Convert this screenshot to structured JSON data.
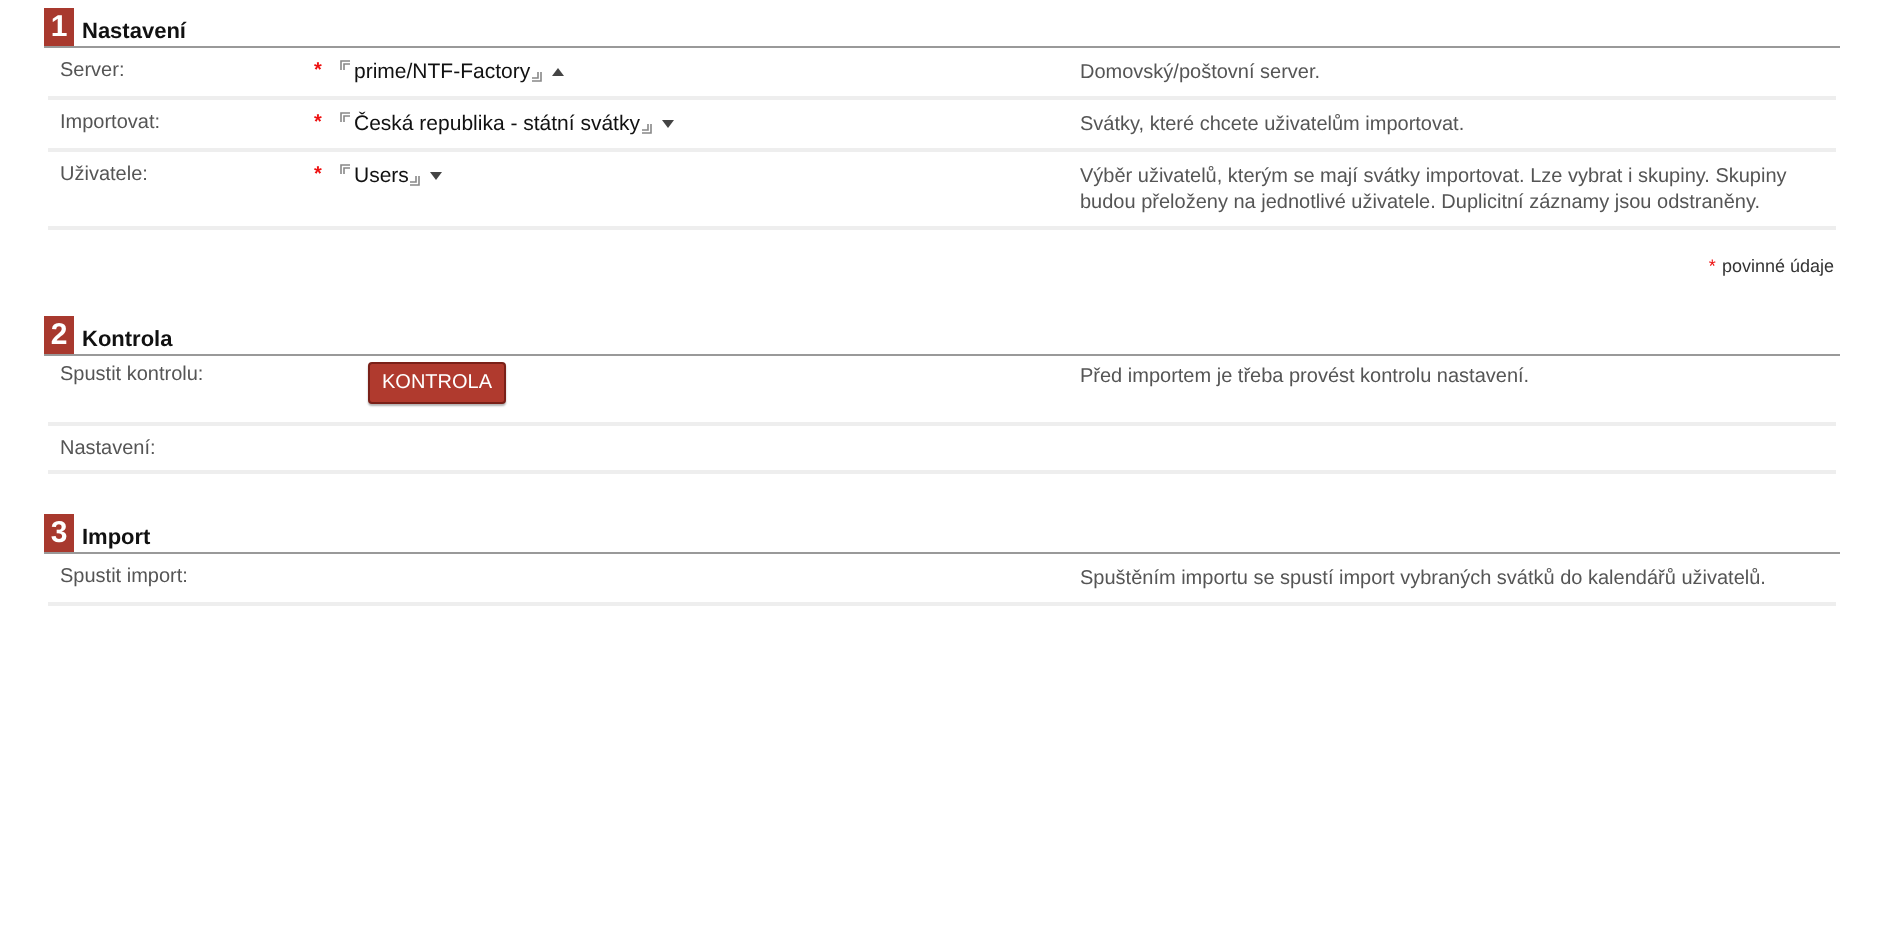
{
  "sections": [
    {
      "number": "1",
      "title": "Nastavení",
      "rows": [
        {
          "label": "Server:",
          "required_mark": "*",
          "kind": "selector",
          "value": "prime/NTF-Factory",
          "expanded": true,
          "description": "Domovský/poštovní server."
        },
        {
          "label": "Importovat:",
          "required_mark": "*",
          "kind": "selector",
          "value": "Česká republika - státní svátky",
          "expanded": false,
          "description": "Svátky, které chcete uživatelům importovat."
        },
        {
          "label": "Uživatele:",
          "required_mark": "*",
          "kind": "selector",
          "value": "Users",
          "expanded": false,
          "description": "Výběr uživatelů, kterým se mají svátky importovat. Lze vybrat i skupiny. Skupiny budou přeloženy na jednotlivé uživatele. Duplicitní záznamy jsou odstraněny."
        }
      ],
      "legend": {
        "mark": "*",
        "text": "povinné údaje"
      }
    },
    {
      "number": "2",
      "title": "Kontrola",
      "rows": [
        {
          "label": "Spustit kontrolu:",
          "kind": "button",
          "button": "KONTROLA",
          "description": "Před importem je třeba provést kontrolu nastavení."
        },
        {
          "label": "Nastavení:",
          "kind": "empty"
        }
      ]
    },
    {
      "number": "3",
      "title": "Import",
      "rows": [
        {
          "label": "Spustit import:",
          "kind": "empty",
          "description": "Spuštěním importu se spustí import vybraných svátků do kalendářů uživatelů."
        }
      ]
    }
  ]
}
